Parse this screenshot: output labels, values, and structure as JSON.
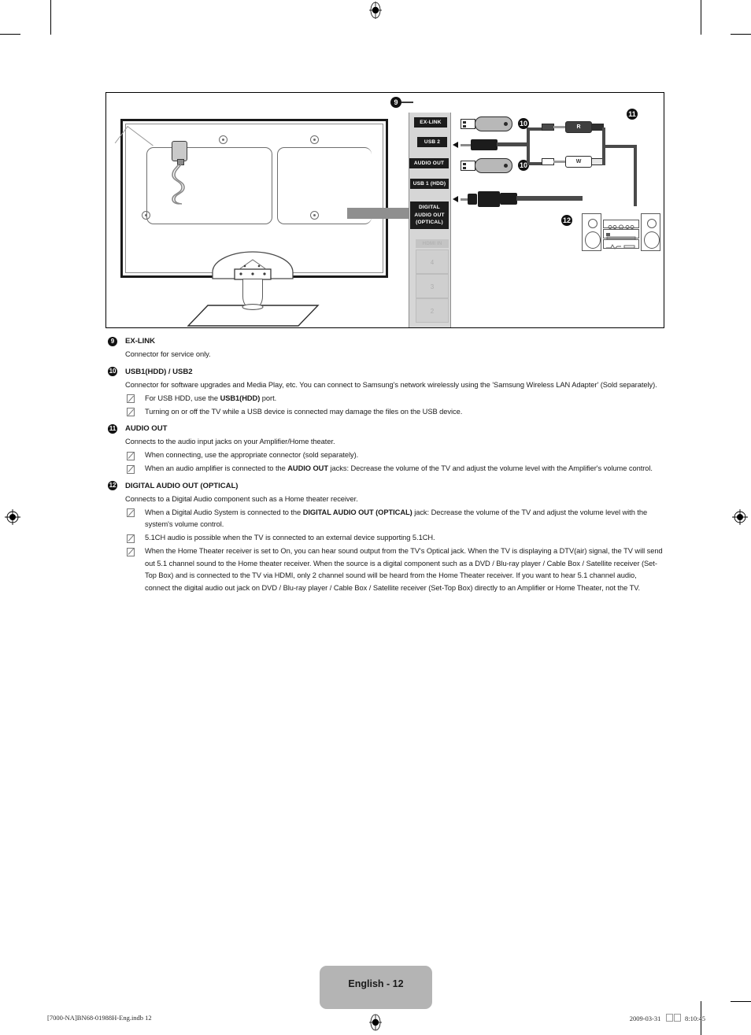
{
  "document": {
    "page_label": "English - 12",
    "footer_left": "[7000-NA]BN68-01988H-Eng.indb   12",
    "footer_right_date": "2009-03-31",
    "footer_right_time": "8:10:45"
  },
  "diagram": {
    "ports": [
      {
        "id": "ex-link",
        "label": "EX-LINK"
      },
      {
        "id": "usb2",
        "label": "USB 2"
      },
      {
        "id": "audio-out",
        "label": "AUDIO OUT"
      },
      {
        "id": "usb1",
        "label": "USB 1 (HDD)"
      },
      {
        "id": "digital-optical",
        "label": "DIGITAL\nAUDIO OUT\n(OPTICAL)"
      }
    ],
    "digital_optical_lines": [
      "DIGITAL",
      "AUDIO OUT",
      "(OPTICAL)"
    ],
    "hdmi_label": "HDMI IN",
    "hdmi_slots": [
      "4",
      "3",
      "2"
    ],
    "callouts": {
      "c9": "9",
      "c10_a": "10",
      "c10_b": "10",
      "c11": "11",
      "c12": "12"
    },
    "rca": {
      "right": "R",
      "white": "W"
    }
  },
  "entries": [
    {
      "num": "9",
      "title": "EX-LINK",
      "desc": "Connector for service only.",
      "notes": []
    },
    {
      "num": "10",
      "title": "USB1(HDD) / USB2",
      "desc": "Connector for software upgrades and Media Play, etc. You can connect to Samsung's network wirelessly using the 'Samsung Wireless LAN Adapter' (Sold separately).",
      "notes": [
        "For USB HDD, use the <b>USB1(HDD)</b> port.",
        "Turning on or off the TV while a USB device is connected may damage the files on the USB device."
      ]
    },
    {
      "num": "11",
      "title": "AUDIO OUT",
      "desc": "Connects to the audio input jacks on your Amplifier/Home theater.",
      "notes": [
        "When connecting, use the appropriate connector (sold separately).",
        "When an audio amplifier is connected to the <b>AUDIO OUT</b> jacks: Decrease the volume of the TV and adjust the volume level with the Amplifier's volume control."
      ]
    },
    {
      "num": "12",
      "title": "DIGITAL AUDIO OUT (OPTICAL)",
      "desc": "Connects to a Digital Audio component such as a Home theater receiver.",
      "notes": [
        "When a Digital Audio System is connected to the <b>DIGITAL AUDIO OUT (OPTICAL)</b> jack: Decrease the volume of the TV and adjust the volume level with the system's volume control.",
        "5.1CH audio is possible when the TV is connected to an external device supporting 5.1CH.",
        "When the Home Theater receiver is set to On, you can hear sound output from the TV's Optical jack. When the TV is displaying a DTV(air) signal, the TV will send out 5.1 channel sound to the Home theater receiver. When the source is a digital component such as a DVD / Blu-ray player / Cable Box / Satellite receiver (Set-Top Box) and is connected to the TV via HDMI, only 2 channel sound will be heard from the Home Theater receiver. If you want to hear 5.1 channel audio, connect the digital audio out jack on DVD / Blu-ray player / Cable Box / Satellite receiver (Set-Top Box) directly to an Amplifier or Home Theater, not the TV."
      ]
    }
  ]
}
